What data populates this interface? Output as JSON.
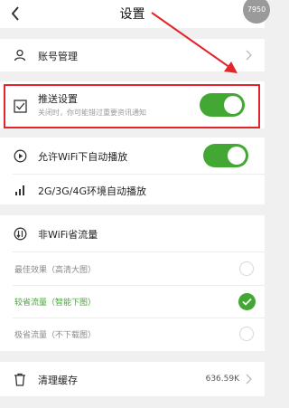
{
  "header": {
    "title": "设置",
    "corner_badge": "7950"
  },
  "account": {
    "label": "账号管理"
  },
  "push": {
    "label": "推送设置",
    "sublabel": "关闭时，你可能错过重要资讯通知",
    "enabled": true
  },
  "wifi_autoplay": {
    "label": "允许WiFi下自动播放",
    "enabled": true
  },
  "mobile_autoplay": {
    "label": "2G/3G/4G环境自动播放"
  },
  "non_wifi": {
    "label": "非WiFi省流量",
    "options": [
      {
        "label": "最佳效果（高清大图）",
        "selected": false
      },
      {
        "label": "较省流量（智能下图）",
        "selected": true
      },
      {
        "label": "极省流量（不下载图）",
        "selected": false
      }
    ]
  },
  "cache": {
    "label": "清理缓存",
    "size": "636.59K"
  },
  "colors": {
    "accent_green": "#43a833",
    "highlight_red": "#e0262b"
  }
}
